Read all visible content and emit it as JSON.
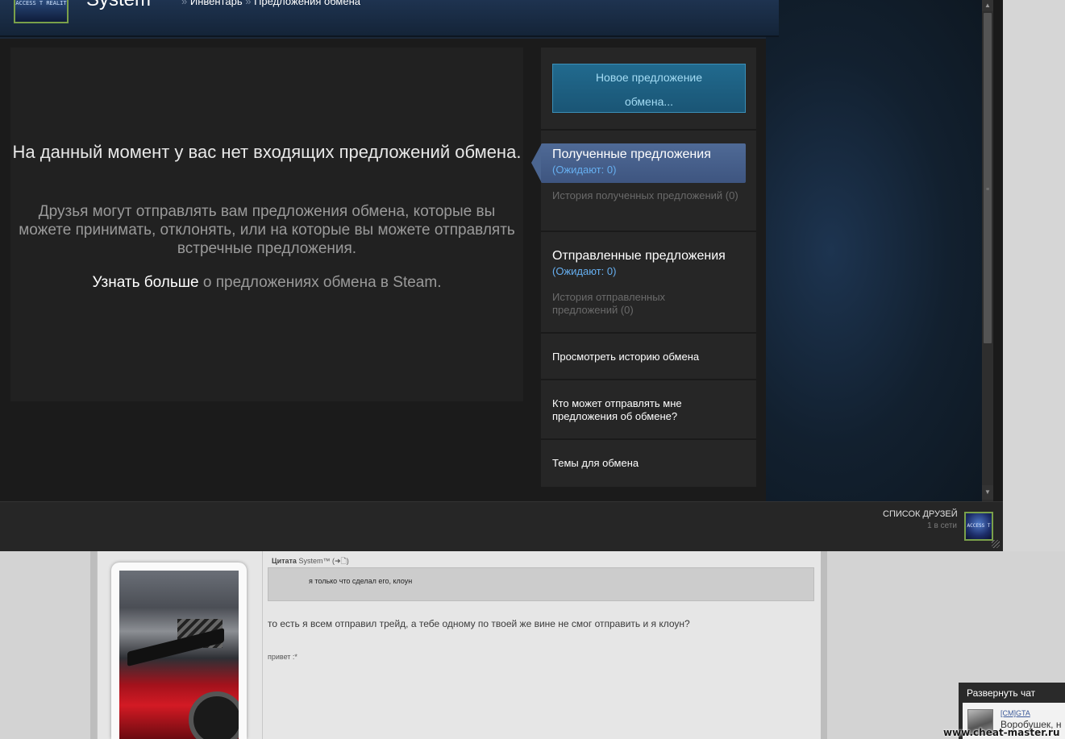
{
  "header": {
    "username": "System",
    "avatar_text": "ACCESS T REALIT",
    "breadcrumb": [
      {
        "label": "Инвентарь"
      },
      {
        "label": "Предложения обмена"
      }
    ],
    "breadcrumb_sep": "»"
  },
  "main": {
    "empty_title": "На данный момент у вас нет входящих предложений обмена.",
    "empty_desc": "Друзья могут отправлять вам предложения обмена, которые вы можете принимать, отклонять, или на которые вы можете отправлять встречные предложения.",
    "learn_more_link": "Узнать больше",
    "learn_more_rest": " о предложениях обмена в Steam."
  },
  "sidebar": {
    "new_offer_line1": "Новое предложение",
    "new_offer_line2": "обмена...",
    "received_label": "Полученные предложения",
    "received_count": "(Ожидают: 0)",
    "received_history": "История полученных предложений (0)",
    "sent_label": "Отправленные предложения",
    "sent_count": "(Ожидают: 0)",
    "sent_history": "История отправленных предложений (0)",
    "trade_history": "Просмотреть историю обмена",
    "who_can_send": "Кто может отправлять мне предложения об обмене?",
    "trade_topics": "Темы для обмена"
  },
  "friends": {
    "label": "СПИСОК ДРУЗЕЙ",
    "online": "1 в сети",
    "avatar_text": "ACCESS T"
  },
  "forum": {
    "quote_label": "Цитата",
    "quote_author": "System™",
    "quote_icons": "(➜🗋)",
    "quote_text": "я только что сделал его, клоун",
    "post_text": "то есть я всем отправил трейд, а тебе одному по твоей же вине не смог отправить и я клоун?",
    "signature": "привет :*"
  },
  "chat": {
    "title": "Развернуть чат",
    "user": "[CM]GTA",
    "message": "Воробушек, н"
  },
  "watermark": "www.cheat-master.ru"
}
